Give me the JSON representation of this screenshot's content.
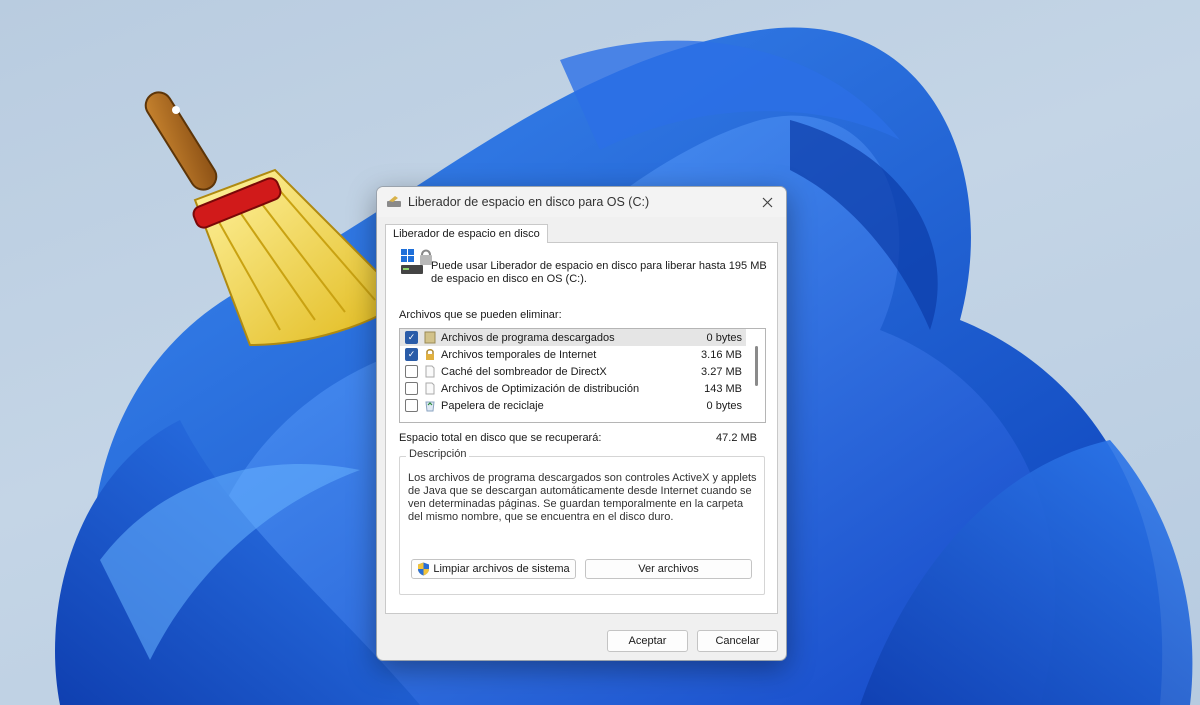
{
  "dialog": {
    "title": "Liberador de espacio en disco para OS (C:)",
    "tab_label": "Liberador de espacio en disco",
    "intro_text": "Puede usar Liberador de espacio en disco para liberar hasta 195 MB de espacio en disco en OS (C:).",
    "files_label": "Archivos que se pueden eliminar:",
    "files": [
      {
        "name": "Archivos de programa descargados",
        "size": "0 bytes",
        "checked": true,
        "selected": true,
        "icon": "folder-icon"
      },
      {
        "name": "Archivos temporales de Internet",
        "size": "3.16 MB",
        "checked": true,
        "selected": false,
        "icon": "lock-icon"
      },
      {
        "name": "Caché del sombreador de DirectX",
        "size": "3.27 MB",
        "checked": false,
        "selected": false,
        "icon": "file-icon"
      },
      {
        "name": "Archivos de Optimización de distribución",
        "size": "143 MB",
        "checked": false,
        "selected": false,
        "icon": "file-icon"
      },
      {
        "name": "Papelera de reciclaje",
        "size": "0 bytes",
        "checked": false,
        "selected": false,
        "icon": "recycle-bin-icon"
      }
    ],
    "total_label": "Espacio total en disco que se recuperará:",
    "total_value": "47.2 MB",
    "description_legend": "Descripción",
    "description_text": "Los archivos de programa descargados son controles ActiveX y applets de Java que se descargan automáticamente desde Internet cuando se ven determinadas páginas. Se guardan temporalmente en la carpeta del mismo nombre, que se encuentra en el disco duro.",
    "cleanup_button": "Limpiar archivos de sistema",
    "view_button": "Ver archivos",
    "ok_button": "Aceptar",
    "cancel_button": "Cancelar"
  },
  "colors": {
    "checkbox_accent": "#2a5ca8",
    "wallpaper_blue": "#1a5fe0",
    "dialog_bg": "#f0f0f0"
  }
}
